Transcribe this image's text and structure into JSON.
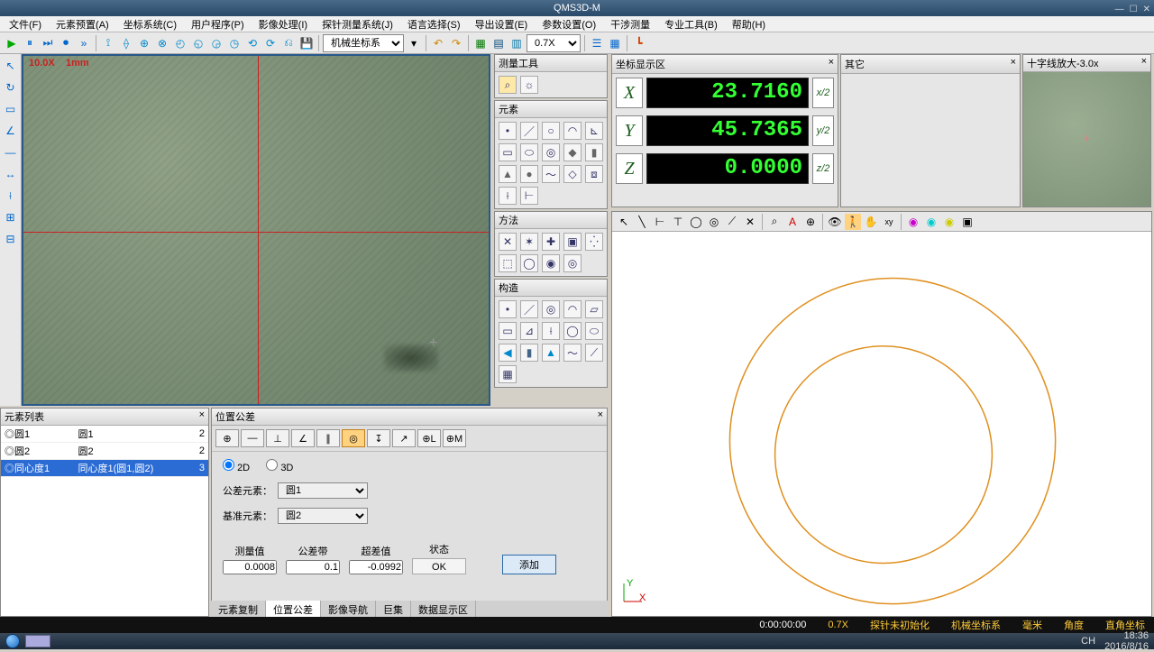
{
  "app_title": "QMS3D-M",
  "menu": [
    "文件(F)",
    "元素预置(A)",
    "坐标系统(C)",
    "用户程序(P)",
    "影像处理(I)",
    "探针测量系统(J)",
    "语言选择(S)",
    "导出设置(E)",
    "参数设置(O)",
    "干涉测量",
    "专业工具(B)",
    "帮助(H)"
  ],
  "toolbar": {
    "coord_system_label": "机械坐标系",
    "zoom_label": "0.7X"
  },
  "video": {
    "ruler_small": "10.0X",
    "ruler_label": "1mm"
  },
  "palettes": {
    "measure_title": "测量工具",
    "elem_title": "元素",
    "method_title": "方法",
    "construct_title": "构造"
  },
  "coord": {
    "title": "坐标显示区",
    "rows": [
      {
        "label": "X",
        "value": "23.7160",
        "half": "x/2"
      },
      {
        "label": "Y",
        "value": "45.7365",
        "half": "y/2"
      },
      {
        "label": "Z",
        "value": "0.0000",
        "half": "z/2"
      }
    ]
  },
  "other_title": "其它",
  "zoom_title": "十字线放大-3.0x",
  "element_list": {
    "title": "元素列表",
    "rows": [
      {
        "icon": "◎",
        "name": "圆1",
        "desc": "圆1",
        "n": "2"
      },
      {
        "icon": "◎",
        "name": "圆2",
        "desc": "圆2",
        "n": "2"
      },
      {
        "icon": "◎",
        "name": "同心度1",
        "desc": "同心度1(圆1,圆2)",
        "n": "3",
        "sel": true
      }
    ]
  },
  "tolerance": {
    "title": "位置公差",
    "mode_2d": "2D",
    "mode_3d": "3D",
    "tol_elem_label": "公差元素：",
    "tol_elem_value": "圆1",
    "datum_label": "基准元素：",
    "datum_value": "圆2",
    "cols": {
      "measured_label": "测量值",
      "measured_value": "0.0008",
      "band_label": "公差带",
      "band_value": "0.1",
      "over_label": "超差值",
      "over_value": "-0.0992",
      "status_label": "状态",
      "status_value": "OK"
    },
    "add_label": "添加"
  },
  "bottom_tabs": [
    "元素复制",
    "位置公差",
    "影像导航",
    "巨集",
    "数据显示区"
  ],
  "status": {
    "time": "0:00:00:00",
    "zoom": "0.7X",
    "probe": "探针未初始化",
    "cs": "机械坐标系",
    "unit": "毫米",
    "angle": "角度",
    "mode": "直角坐标"
  },
  "tray": {
    "lang": "CH",
    "clock": "18:36",
    "date": "2016/8/16"
  }
}
